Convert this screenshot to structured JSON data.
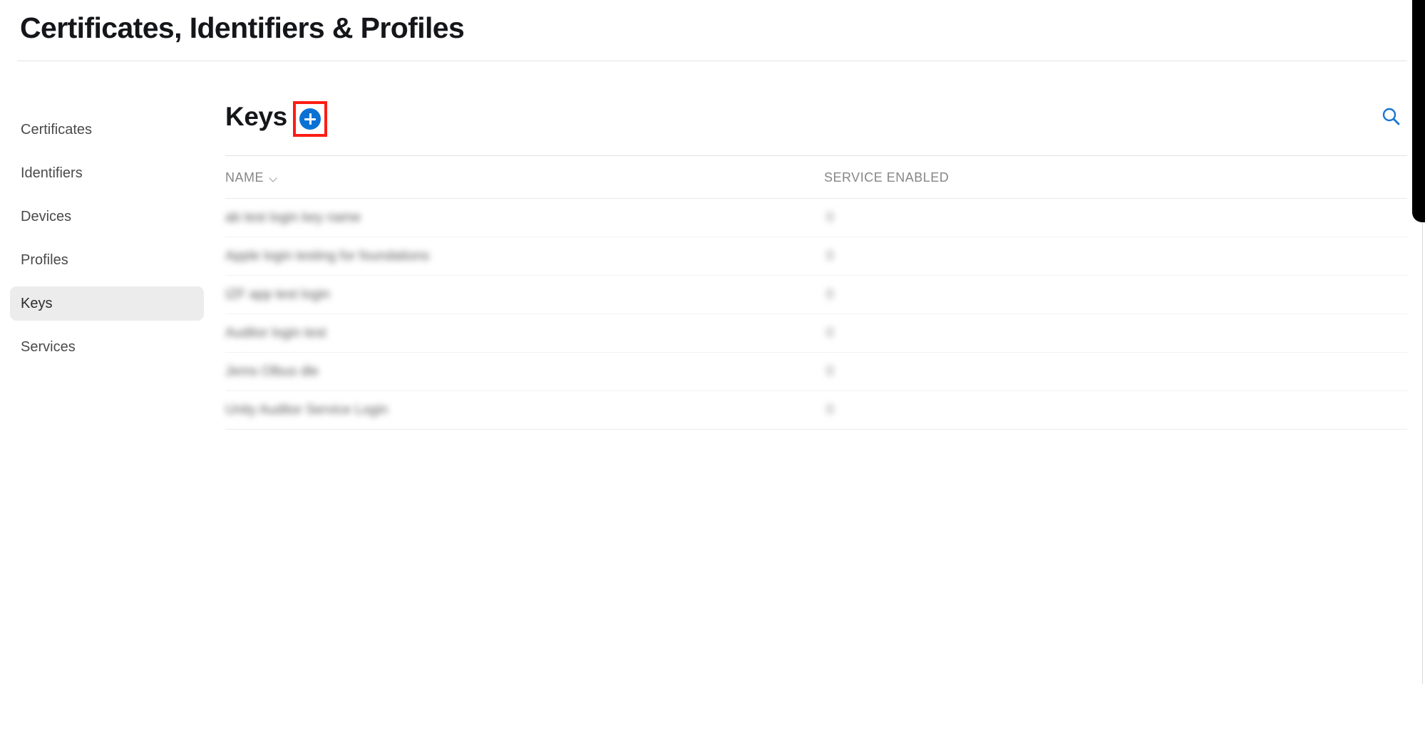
{
  "header": {
    "title": "Certificates, Identifiers & Profiles"
  },
  "sidebar": {
    "items": [
      {
        "label": "Certificates",
        "selected": false
      },
      {
        "label": "Identifiers",
        "selected": false
      },
      {
        "label": "Devices",
        "selected": false
      },
      {
        "label": "Profiles",
        "selected": false
      },
      {
        "label": "Keys",
        "selected": true
      },
      {
        "label": "Services",
        "selected": false
      }
    ]
  },
  "main": {
    "section_title": "Keys",
    "add_button_label": "+",
    "add_button_icon": "plus-circle-icon",
    "add_button_color": "#0b72d4",
    "highlight_color": "#fc1d13",
    "search_icon": "search-icon",
    "search_icon_color": "#1a76d2"
  },
  "table": {
    "columns": [
      {
        "key": "name",
        "label": "NAME",
        "sortable": true,
        "sort_icon": "chevron-down-icon"
      },
      {
        "key": "service_enabled",
        "label": "SERVICE ENABLED",
        "sortable": false
      }
    ],
    "rows": [
      {
        "name": "ab test login key name",
        "service_enabled": "0",
        "redacted": true
      },
      {
        "name": "Apple login testing for foundations",
        "service_enabled": "0",
        "redacted": true
      },
      {
        "name": "IZF app test login",
        "service_enabled": "0",
        "redacted": true
      },
      {
        "name": "Auditor login test",
        "service_enabled": "0",
        "redacted": true
      },
      {
        "name": "Jems Olbus dle",
        "service_enabled": "0",
        "redacted": true
      },
      {
        "name": "Unity Auditor Service Login",
        "service_enabled": "0",
        "redacted": true
      }
    ]
  }
}
